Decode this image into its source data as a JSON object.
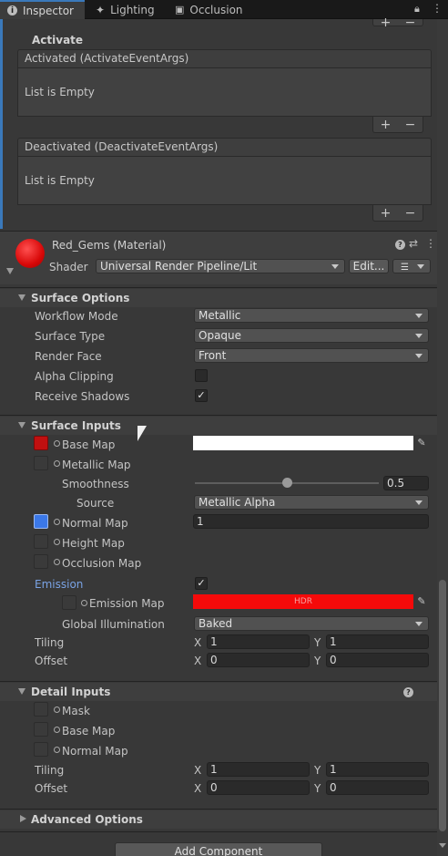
{
  "tabs": [
    {
      "label": "Inspector",
      "icon": "info-icon"
    },
    {
      "label": "Lighting",
      "icon": "lighting-icon"
    },
    {
      "label": "Occlusion",
      "icon": "occlusion-icon"
    }
  ],
  "events": {
    "section_label": "Activate",
    "activated_header": "Activated (ActivateEventArgs)",
    "activated_empty": "List is Empty",
    "deactivated_header": "Deactivated (DeactivateEventArgs)",
    "deactivated_empty": "List is Empty",
    "add_symbol": "+",
    "remove_symbol": "−"
  },
  "material": {
    "name": "Red_Gems (Material)",
    "shader_label": "Shader",
    "shader_value": "Universal Render Pipeline/Lit",
    "edit_label": "Edit...",
    "preview_color": "#e01010"
  },
  "surface_options": {
    "title": "Surface Options",
    "rows": [
      {
        "label": "Workflow Mode",
        "value": "Metallic"
      },
      {
        "label": "Surface Type",
        "value": "Opaque"
      },
      {
        "label": "Render Face",
        "value": "Front"
      }
    ],
    "alpha_clipping_label": "Alpha Clipping",
    "alpha_clipping_checked": false,
    "receive_shadows_label": "Receive Shadows",
    "receive_shadows_checked": true
  },
  "surface_inputs": {
    "title": "Surface Inputs",
    "base_map_label": "Base Map",
    "metallic_map_label": "Metallic Map",
    "smoothness_label": "Smoothness",
    "smoothness_value": "0.5",
    "smoothness_fraction": 0.5,
    "source_label": "Source",
    "source_value": "Metallic Alpha",
    "normal_map_label": "Normal Map",
    "normal_map_value": "1",
    "height_map_label": "Height Map",
    "occlusion_map_label": "Occlusion Map",
    "emission_label": "Emission",
    "emission_checked": true,
    "emission_map_label": "Emission Map",
    "emission_color_text": "HDR",
    "emission_color": "#f50a0a",
    "gi_label": "Global Illumination",
    "gi_value": "Baked",
    "tiling_label": "Tiling",
    "offset_label": "Offset",
    "tiling_x": "1",
    "tiling_y": "1",
    "offset_x": "0",
    "offset_y": "0",
    "x_label": "X",
    "y_label": "Y"
  },
  "detail_inputs": {
    "title": "Detail Inputs",
    "mask_label": "Mask",
    "base_map_label": "Base Map",
    "normal_map_label": "Normal Map",
    "tiling_label": "Tiling",
    "offset_label": "Offset",
    "tiling_x": "1",
    "tiling_y": "1",
    "offset_x": "0",
    "offset_y": "0",
    "x_label": "X",
    "y_label": "Y"
  },
  "advanced_options": {
    "title": "Advanced Options"
  },
  "add_component_label": "Add Component",
  "colors": {
    "accent": "#3a79bb",
    "emission_text": "#7aa3e5",
    "normal_swatch": "#3b78e8"
  }
}
